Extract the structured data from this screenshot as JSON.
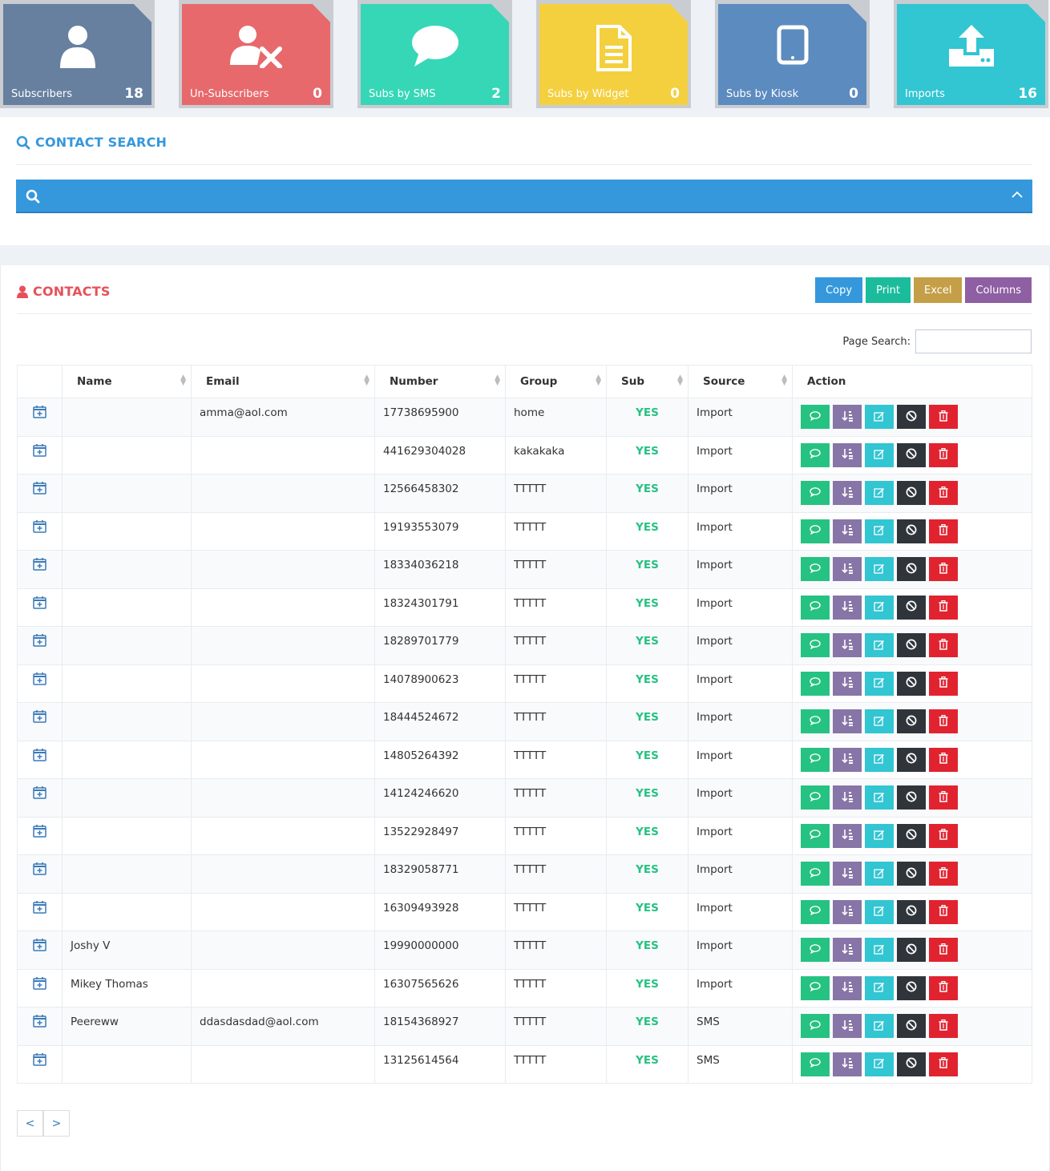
{
  "tiles": [
    {
      "label": "Subscribers",
      "count": "18",
      "color": "#67809f",
      "icon": "user-icon"
    },
    {
      "label": "Un-Subscribers",
      "count": "0",
      "color": "#e7696c",
      "icon": "user-remove-icon"
    },
    {
      "label": "Subs by SMS",
      "count": "2",
      "color": "#36d7b7",
      "icon": "chat-bubble-icon"
    },
    {
      "label": "Subs by Widget",
      "count": "0",
      "color": "#f4d03f",
      "icon": "document-icon"
    },
    {
      "label": "Subs by Kiosk",
      "count": "0",
      "color": "#5c8bc0",
      "icon": "tablet-icon"
    },
    {
      "label": "Imports",
      "count": "16",
      "color": "#32c5d2",
      "icon": "upload-icon"
    }
  ],
  "search": {
    "title": "CONTACT SEARCH"
  },
  "contacts": {
    "title": "CONTACTS",
    "buttons": [
      {
        "label": "Copy",
        "color": "#3598dc"
      },
      {
        "label": "Print",
        "color": "#1bbc9b"
      },
      {
        "label": "Excel",
        "color": "#c49f47"
      },
      {
        "label": "Columns",
        "color": "#8e5fa2"
      }
    ],
    "page_search_label": "Page Search:",
    "columns": [
      "",
      "Name",
      "Email",
      "Number",
      "Group",
      "Sub",
      "Source",
      "Action"
    ],
    "rows": [
      {
        "name": "",
        "email": "amma@aol.com",
        "number": "17738695900",
        "group": "home",
        "sub": "YES",
        "source": "Import"
      },
      {
        "name": "",
        "email": "",
        "number": "441629304028",
        "group": "kakakaka",
        "sub": "YES",
        "source": "Import"
      },
      {
        "name": "",
        "email": "",
        "number": "12566458302",
        "group": "TTTTT",
        "sub": "YES",
        "source": "Import"
      },
      {
        "name": "",
        "email": "",
        "number": "19193553079",
        "group": "TTTTT",
        "sub": "YES",
        "source": "Import"
      },
      {
        "name": "",
        "email": "",
        "number": "18334036218",
        "group": "TTTTT",
        "sub": "YES",
        "source": "Import"
      },
      {
        "name": "",
        "email": "",
        "number": "18324301791",
        "group": "TTTTT",
        "sub": "YES",
        "source": "Import"
      },
      {
        "name": "",
        "email": "",
        "number": "18289701779",
        "group": "TTTTT",
        "sub": "YES",
        "source": "Import"
      },
      {
        "name": "",
        "email": "",
        "number": "14078900623",
        "group": "TTTTT",
        "sub": "YES",
        "source": "Import"
      },
      {
        "name": "",
        "email": "",
        "number": "18444524672",
        "group": "TTTTT",
        "sub": "YES",
        "source": "Import"
      },
      {
        "name": "",
        "email": "",
        "number": "14805264392",
        "group": "TTTTT",
        "sub": "YES",
        "source": "Import"
      },
      {
        "name": "",
        "email": "",
        "number": "14124246620",
        "group": "TTTTT",
        "sub": "YES",
        "source": "Import"
      },
      {
        "name": "",
        "email": "",
        "number": "13522928497",
        "group": "TTTTT",
        "sub": "YES",
        "source": "Import"
      },
      {
        "name": "",
        "email": "",
        "number": "18329058771",
        "group": "TTTTT",
        "sub": "YES",
        "source": "Import"
      },
      {
        "name": "",
        "email": "",
        "number": "16309493928",
        "group": "TTTTT",
        "sub": "YES",
        "source": "Import"
      },
      {
        "name": "Joshy V",
        "email": "",
        "number": "19990000000",
        "group": "TTTTT",
        "sub": "YES",
        "source": "Import"
      },
      {
        "name": "Mikey Thomas",
        "email": "",
        "number": "16307565626",
        "group": "TTTTT",
        "sub": "YES",
        "source": "Import"
      },
      {
        "name": "Peereww",
        "email": "ddasdasdad@aol.com",
        "number": "18154368927",
        "group": "TTTTT",
        "sub": "YES",
        "source": "SMS"
      },
      {
        "name": "",
        "email": "",
        "number": "13125614564",
        "group": "TTTTT",
        "sub": "YES",
        "source": "SMS"
      }
    ],
    "actions": [
      {
        "icon": "message-icon",
        "color": "#26c281"
      },
      {
        "icon": "sort-icon",
        "color": "#8775a7"
      },
      {
        "icon": "edit-icon",
        "color": "#32c5d2"
      },
      {
        "icon": "block-icon",
        "color": "#2f353b"
      },
      {
        "icon": "trash-icon",
        "color": "#e12330"
      }
    ],
    "pager": {
      "prev": "<",
      "next": ">"
    }
  }
}
